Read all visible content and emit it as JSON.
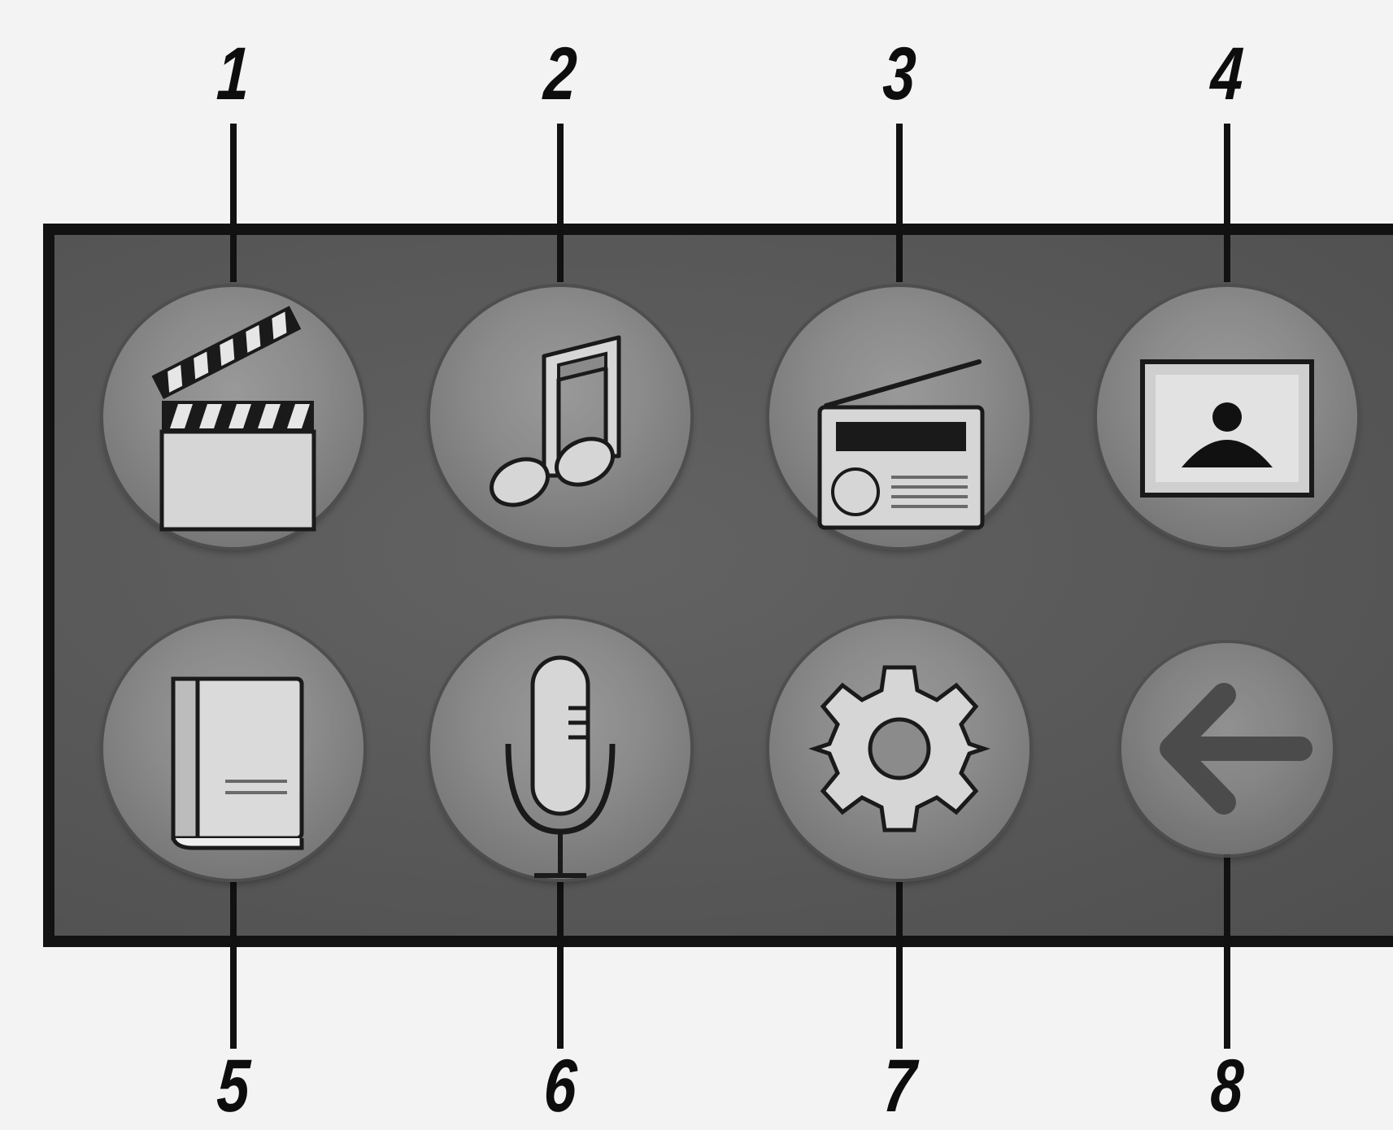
{
  "callouts": [
    "1",
    "2",
    "3",
    "4",
    "5",
    "6",
    "7",
    "8"
  ],
  "buttons": [
    {
      "icon": "movie-clapperboard-icon"
    },
    {
      "icon": "music-note-icon"
    },
    {
      "icon": "radio-icon"
    },
    {
      "icon": "photo-icon"
    },
    {
      "icon": "book-icon"
    },
    {
      "icon": "microphone-icon"
    },
    {
      "icon": "gear-icon"
    },
    {
      "icon": "back-arrow-icon"
    }
  ],
  "colors": {
    "panel": "#585858",
    "button": "#8b8b8b",
    "icon_fill": "#d6d6d6",
    "border": "#121212"
  }
}
